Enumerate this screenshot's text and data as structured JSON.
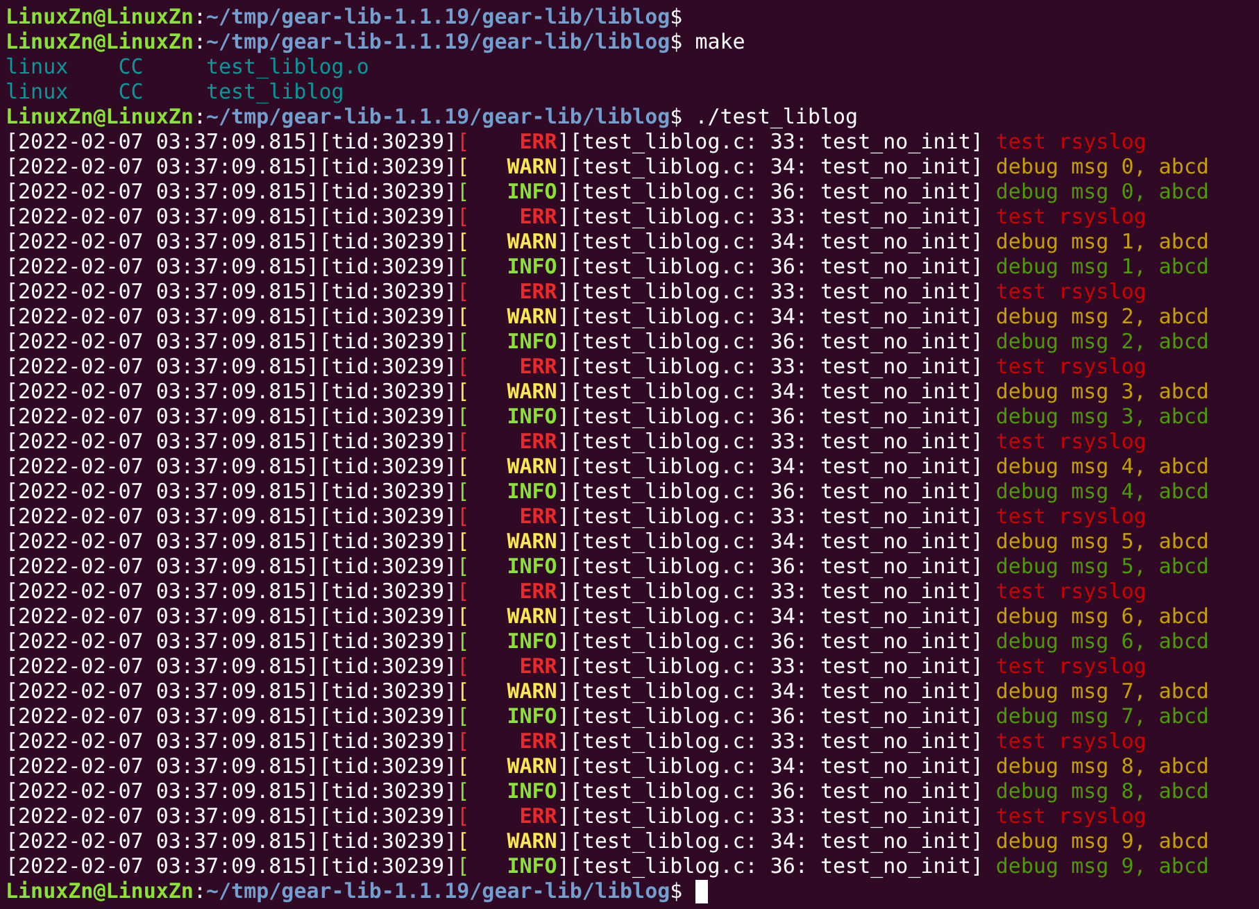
{
  "terminal": {
    "lines": [
      {
        "kind": "prompt",
        "user": "LinuxZn@LinuxZn",
        "sep": ":",
        "path": "~/tmp/gear-lib-1.1.19/gear-lib/liblog",
        "dollar": "$"
      },
      {
        "kind": "prompt",
        "user": "LinuxZn@LinuxZn",
        "sep": ":",
        "path": "~/tmp/gear-lib-1.1.19/gear-lib/liblog",
        "dollar": "$",
        "command": "make"
      },
      {
        "kind": "build",
        "target": "linux",
        "tool": "CC",
        "file": "test_liblog.o"
      },
      {
        "kind": "build",
        "target": "linux",
        "tool": "CC",
        "file": "test_liblog"
      },
      {
        "kind": "prompt",
        "user": "LinuxZn@LinuxZn",
        "sep": ":",
        "path": "~/tmp/gear-lib-1.1.19/gear-lib/liblog",
        "dollar": "$",
        "command": "./test_liblog"
      },
      {
        "kind": "err",
        "stamp": "[2022-02-07 03:37:09.815][tid:30239]",
        "open": "[",
        "tag": "ERR",
        "source": "][test_liblog.c: 33: test_no_init]",
        "message": "test rsyslog"
      },
      {
        "kind": "warn",
        "stamp": "[2022-02-07 03:37:09.815][tid:30239]",
        "open": "[",
        "tag": "WARN",
        "source": "][test_liblog.c: 34: test_no_init]",
        "message": "debug msg 0, abcd"
      },
      {
        "kind": "info",
        "stamp": "[2022-02-07 03:37:09.815][tid:30239]",
        "open": "[",
        "tag": "INFO",
        "source": "][test_liblog.c: 36: test_no_init]",
        "message": "debug msg 0, abcd"
      },
      {
        "kind": "err",
        "stamp": "[2022-02-07 03:37:09.815][tid:30239]",
        "open": "[",
        "tag": "ERR",
        "source": "][test_liblog.c: 33: test_no_init]",
        "message": "test rsyslog"
      },
      {
        "kind": "warn",
        "stamp": "[2022-02-07 03:37:09.815][tid:30239]",
        "open": "[",
        "tag": "WARN",
        "source": "][test_liblog.c: 34: test_no_init]",
        "message": "debug msg 1, abcd"
      },
      {
        "kind": "info",
        "stamp": "[2022-02-07 03:37:09.815][tid:30239]",
        "open": "[",
        "tag": "INFO",
        "source": "][test_liblog.c: 36: test_no_init]",
        "message": "debug msg 1, abcd"
      },
      {
        "kind": "err",
        "stamp": "[2022-02-07 03:37:09.815][tid:30239]",
        "open": "[",
        "tag": "ERR",
        "source": "][test_liblog.c: 33: test_no_init]",
        "message": "test rsyslog"
      },
      {
        "kind": "warn",
        "stamp": "[2022-02-07 03:37:09.815][tid:30239]",
        "open": "[",
        "tag": "WARN",
        "source": "][test_liblog.c: 34: test_no_init]",
        "message": "debug msg 2, abcd"
      },
      {
        "kind": "info",
        "stamp": "[2022-02-07 03:37:09.815][tid:30239]",
        "open": "[",
        "tag": "INFO",
        "source": "][test_liblog.c: 36: test_no_init]",
        "message": "debug msg 2, abcd"
      },
      {
        "kind": "err",
        "stamp": "[2022-02-07 03:37:09.815][tid:30239]",
        "open": "[",
        "tag": "ERR",
        "source": "][test_liblog.c: 33: test_no_init]",
        "message": "test rsyslog"
      },
      {
        "kind": "warn",
        "stamp": "[2022-02-07 03:37:09.815][tid:30239]",
        "open": "[",
        "tag": "WARN",
        "source": "][test_liblog.c: 34: test_no_init]",
        "message": "debug msg 3, abcd"
      },
      {
        "kind": "info",
        "stamp": "[2022-02-07 03:37:09.815][tid:30239]",
        "open": "[",
        "tag": "INFO",
        "source": "][test_liblog.c: 36: test_no_init]",
        "message": "debug msg 3, abcd"
      },
      {
        "kind": "err",
        "stamp": "[2022-02-07 03:37:09.815][tid:30239]",
        "open": "[",
        "tag": "ERR",
        "source": "][test_liblog.c: 33: test_no_init]",
        "message": "test rsyslog"
      },
      {
        "kind": "warn",
        "stamp": "[2022-02-07 03:37:09.815][tid:30239]",
        "open": "[",
        "tag": "WARN",
        "source": "][test_liblog.c: 34: test_no_init]",
        "message": "debug msg 4, abcd"
      },
      {
        "kind": "info",
        "stamp": "[2022-02-07 03:37:09.815][tid:30239]",
        "open": "[",
        "tag": "INFO",
        "source": "][test_liblog.c: 36: test_no_init]",
        "message": "debug msg 4, abcd"
      },
      {
        "kind": "err",
        "stamp": "[2022-02-07 03:37:09.815][tid:30239]",
        "open": "[",
        "tag": "ERR",
        "source": "][test_liblog.c: 33: test_no_init]",
        "message": "test rsyslog"
      },
      {
        "kind": "warn",
        "stamp": "[2022-02-07 03:37:09.815][tid:30239]",
        "open": "[",
        "tag": "WARN",
        "source": "][test_liblog.c: 34: test_no_init]",
        "message": "debug msg 5, abcd"
      },
      {
        "kind": "info",
        "stamp": "[2022-02-07 03:37:09.815][tid:30239]",
        "open": "[",
        "tag": "INFO",
        "source": "][test_liblog.c: 36: test_no_init]",
        "message": "debug msg 5, abcd"
      },
      {
        "kind": "err",
        "stamp": "[2022-02-07 03:37:09.815][tid:30239]",
        "open": "[",
        "tag": "ERR",
        "source": "][test_liblog.c: 33: test_no_init]",
        "message": "test rsyslog"
      },
      {
        "kind": "warn",
        "stamp": "[2022-02-07 03:37:09.815][tid:30239]",
        "open": "[",
        "tag": "WARN",
        "source": "][test_liblog.c: 34: test_no_init]",
        "message": "debug msg 6, abcd"
      },
      {
        "kind": "info",
        "stamp": "[2022-02-07 03:37:09.815][tid:30239]",
        "open": "[",
        "tag": "INFO",
        "source": "][test_liblog.c: 36: test_no_init]",
        "message": "debug msg 6, abcd"
      },
      {
        "kind": "err",
        "stamp": "[2022-02-07 03:37:09.815][tid:30239]",
        "open": "[",
        "tag": "ERR",
        "source": "][test_liblog.c: 33: test_no_init]",
        "message": "test rsyslog"
      },
      {
        "kind": "warn",
        "stamp": "[2022-02-07 03:37:09.815][tid:30239]",
        "open": "[",
        "tag": "WARN",
        "source": "][test_liblog.c: 34: test_no_init]",
        "message": "debug msg 7, abcd"
      },
      {
        "kind": "info",
        "stamp": "[2022-02-07 03:37:09.815][tid:30239]",
        "open": "[",
        "tag": "INFO",
        "source": "][test_liblog.c: 36: test_no_init]",
        "message": "debug msg 7, abcd"
      },
      {
        "kind": "err",
        "stamp": "[2022-02-07 03:37:09.815][tid:30239]",
        "open": "[",
        "tag": "ERR",
        "source": "][test_liblog.c: 33: test_no_init]",
        "message": "test rsyslog"
      },
      {
        "kind": "warn",
        "stamp": "[2022-02-07 03:37:09.815][tid:30239]",
        "open": "[",
        "tag": "WARN",
        "source": "][test_liblog.c: 34: test_no_init]",
        "message": "debug msg 8, abcd"
      },
      {
        "kind": "info",
        "stamp": "[2022-02-07 03:37:09.815][tid:30239]",
        "open": "[",
        "tag": "INFO",
        "source": "][test_liblog.c: 36: test_no_init]",
        "message": "debug msg 8, abcd"
      },
      {
        "kind": "err",
        "stamp": "[2022-02-07 03:37:09.815][tid:30239]",
        "open": "[",
        "tag": "ERR",
        "source": "][test_liblog.c: 33: test_no_init]",
        "message": "test rsyslog"
      },
      {
        "kind": "warn",
        "stamp": "[2022-02-07 03:37:09.815][tid:30239]",
        "open": "[",
        "tag": "WARN",
        "source": "][test_liblog.c: 34: test_no_init]",
        "message": "debug msg 9, abcd"
      },
      {
        "kind": "info",
        "stamp": "[2022-02-07 03:37:09.815][tid:30239]",
        "open": "[",
        "tag": "INFO",
        "source": "][test_liblog.c: 36: test_no_init]",
        "message": "debug msg 9, abcd"
      },
      {
        "kind": "prompt",
        "user": "LinuxZn@LinuxZn",
        "sep": ":",
        "path": "~/tmp/gear-lib-1.1.19/gear-lib/liblog",
        "dollar": "$",
        "cursor": true
      }
    ]
  }
}
